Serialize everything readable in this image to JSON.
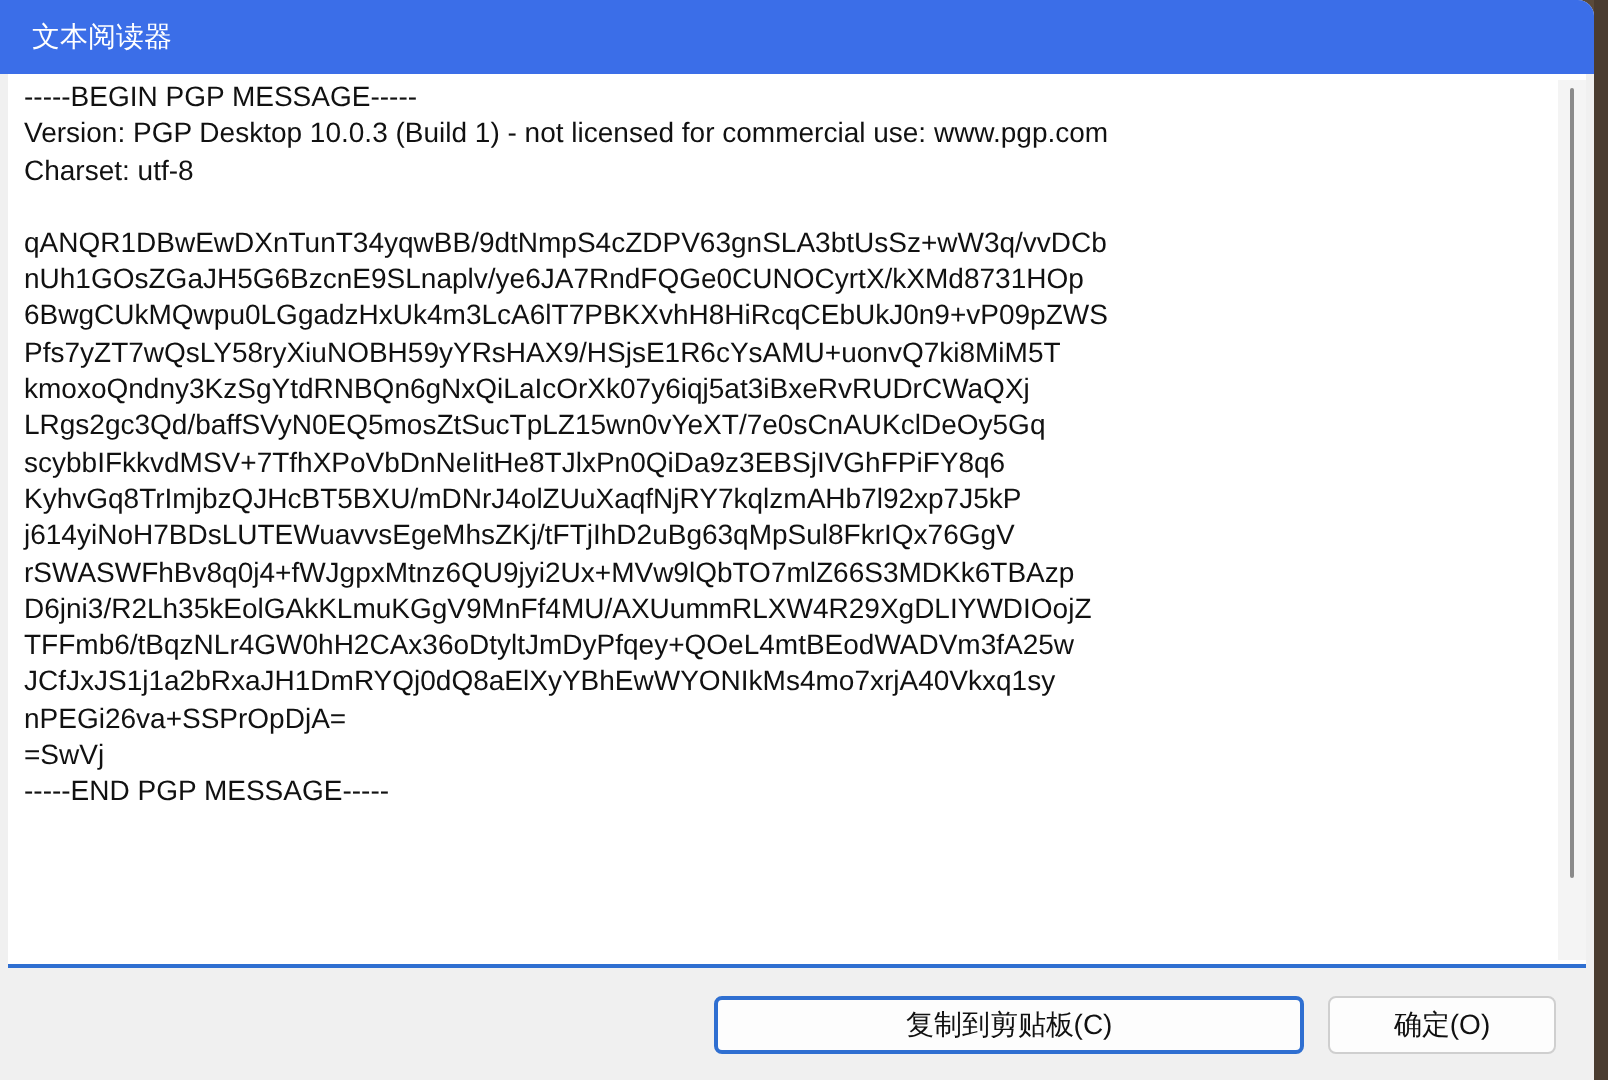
{
  "window": {
    "title": "文本阅读器"
  },
  "text": {
    "header_lines": [
      "-----BEGIN PGP MESSAGE-----",
      "Version: PGP Desktop 10.0.3 (Build 1) - not licensed for commercial use: www.pgp.com",
      "Charset: utf-8"
    ],
    "body_lines": [
      "qANQR1DBwEwDXnTunT34yqwBB/9dtNmpS4cZDPV63gnSLA3btUsSz+wW3q/vvDCb",
      "nUh1GOsZGaJH5G6BzcnE9SLnaplv/ye6JA7RndFQGe0CUNOCyrtX/kXMd8731HOp",
      "6BwgCUkMQwpu0LGgadzHxUk4m3LcA6lT7PBKXvhH8HiRcqCEbUkJ0n9+vP09pZWS",
      "Pfs7yZT7wQsLY58ryXiuNOBH59yYRsHAX9/HSjsE1R6cYsAMU+uonvQ7ki8MiM5T",
      "kmoxoQndny3KzSgYtdRNBQn6gNxQiLaIcOrXk07y6iqj5at3iBxeRvRUDrCWaQXj",
      "LRgs2gc3Qd/baffSVyN0EQ5mosZtSucTpLZ15wn0vYeXT/7e0sCnAUKclDeOy5Gq",
      "scybbIFkkvdMSV+7TfhXPoVbDnNeIitHe8TJlxPn0QiDa9z3EBSjIVGhFPiFY8q6",
      "KyhvGq8TrImjbzQJHcBT5BXU/mDNrJ4olZUuXaqfNjRY7kqlzmAHb7l92xp7J5kP",
      "j614yiNoH7BDsLUTEWuavvsEgeMhsZKj/tFTjIhD2uBg63qMpSul8FkrIQx76GgV",
      "rSWASWFhBv8q0j4+fWJgpxMtnz6QU9jyi2Ux+MVw9lQbTO7mlZ66S3MDKk6TBAzp",
      "D6jni3/R2Lh35kEolGAkKLmuKGgV9MnFf4MU/AXUummRLXW4R29XgDLIYWDIOojZ",
      "TFFmb6/tBqzNLr4GW0hH2CAx36oDtyltJmDyPfqey+QOeL4mtBEodWADVm3fA25w",
      "JCfJxJS1j1a2bRxaJH1DmRYQj0dQ8aElXyYBhEwWYONIkMs4mo7xrjA40Vkxq1sy",
      "nPEGi26va+SSPrOpDjA=",
      "=SwVj",
      "-----END PGP MESSAGE-----"
    ]
  },
  "buttons": [
    {
      "label": "复制到剪贴板(C)",
      "focused": true
    },
    {
      "label": "确定(O)",
      "focused": false
    }
  ]
}
